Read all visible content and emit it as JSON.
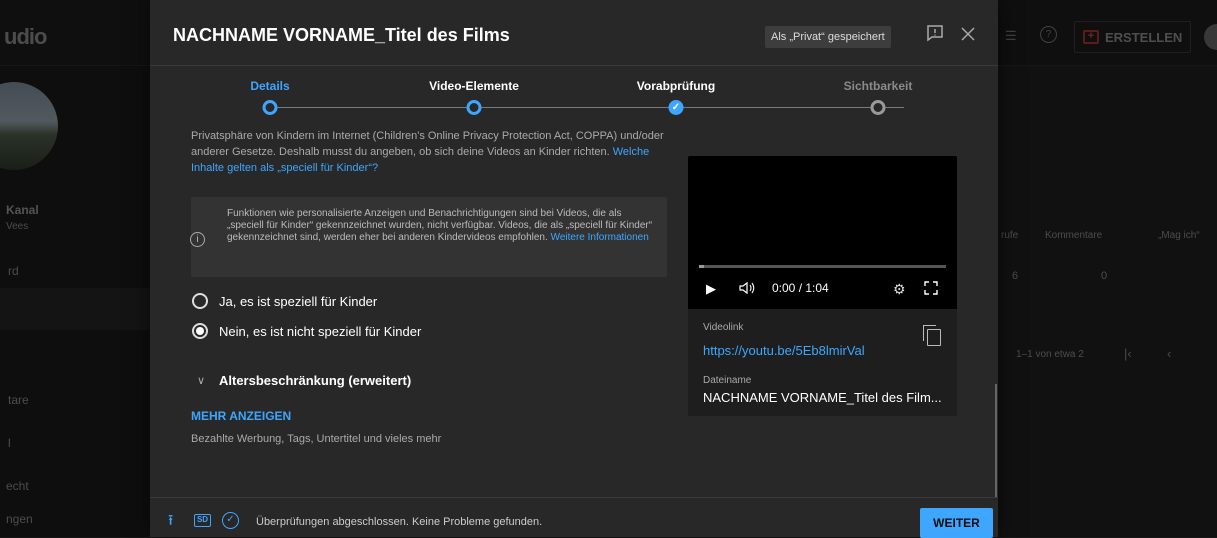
{
  "background": {
    "logo": "udio",
    "channel_label": "Kanal",
    "channel_sub": "Vees",
    "side_items": [
      "rd",
      "tare",
      "l",
      "echt",
      "ngen"
    ],
    "create_label": "ERSTELLEN",
    "table_headers": [
      "rufe",
      "Kommentare",
      "„Mag ich“"
    ],
    "table_values": [
      "6",
      "0"
    ],
    "pagination": "1–1 von etwa 2"
  },
  "dialog": {
    "title": "NACHNAME VORNAME_Titel des Films",
    "saved_chip": "Als „Privat“ gespeichert",
    "feedback_icon": "feedback-icon",
    "close_icon": "close-icon"
  },
  "stepper": {
    "steps": [
      {
        "label": "Details",
        "state": "current"
      },
      {
        "label": "Video-Elemente",
        "state": "current"
      },
      {
        "label": "Vorabprüfung",
        "state": "done"
      },
      {
        "label": "Sichtbarkeit",
        "state": "pending"
      }
    ]
  },
  "content": {
    "paragraph_text": "Privatsphäre von Kindern im Internet (Children's Online Privacy Protection Act, COPPA) und/oder anderer Gesetze. Deshalb musst du angeben, ob sich deine Videos an Kinder richten.",
    "paragraph_link": "Welche Inhalte gelten als „speciell für Kinder“?",
    "info_text": "Funktionen wie personalisierte Anzeigen und Benachrichtigungen sind bei Videos, die als „speciell für Kinder“ gekennzeichnet wurden, nicht verfügbar. Videos, die als „speciell für Kinder“ gekennzeichnet sind, werden eher bei anderen Kindervideos empfohlen.",
    "info_link": "Weitere Informationen",
    "radio_yes": "Ja, es ist speziell für Kinder",
    "radio_no": "Nein, es ist nicht speziell für Kinder",
    "age_restriction": "Altersbeschränkung (erweitert)",
    "show_more": "MEHR ANZEIGEN",
    "show_more_sub": "Bezahlte Werbung, Tags, Untertitel und vieles mehr"
  },
  "preview": {
    "time": "0:00 / 1:04",
    "progress_fraction": 0.02,
    "video_link_label": "Videolink",
    "video_link": "https://youtu.be/5Eb8lmirVal",
    "file_label": "Dateiname",
    "file_name": "NACHNAME VORNAME_Titel des Film..."
  },
  "footer": {
    "sd_badge": "SD",
    "status": "Überprüfungen abgeschlossen. Keine Probleme gefunden.",
    "next_button": "WEITER"
  },
  "colors": {
    "accent": "#3ea6ff",
    "dialog_bg": "#282828"
  }
}
